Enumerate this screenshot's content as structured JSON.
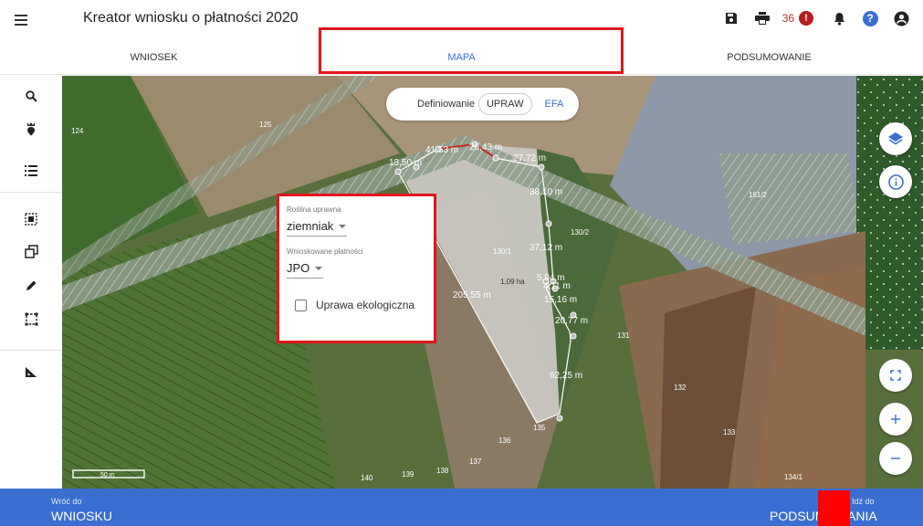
{
  "app": {
    "title": "Kreator wniosku o płatności 2020",
    "notification_count": "36"
  },
  "tabs": [
    {
      "label": "WNIOSEK"
    },
    {
      "label": "MAPA"
    },
    {
      "label": "PODSUMOWANIE"
    }
  ],
  "map_mode": {
    "label": "Definiowanie",
    "upraw": "UPRAW",
    "efa": "EFA"
  },
  "popup": {
    "crop_label": "Roślina uprawna",
    "crop_value": "ziemniak",
    "payments_label": "Wnioskowane płatności",
    "payments_value": "JPO",
    "eco_label": "Uprawa ekologiczna"
  },
  "parcels": [
    "124",
    "125",
    "130/2",
    "130/1",
    "161/2",
    "131",
    "132",
    "133",
    "134/1",
    "135",
    "136",
    "137",
    "138",
    "139",
    "140"
  ],
  "measurements": [
    "41,53 m",
    "25,43 m",
    "27,72 m",
    "13,50 m",
    "38,10 m",
    "37,12 m",
    "205,55 m",
    "5,94 m",
    "4,11 m",
    "15,16 m",
    "20,77 m",
    "62,25 m"
  ],
  "area_label": "1,09 ha",
  "scale_label": "50 m",
  "bottom": {
    "back_small": "Wróć do",
    "back_big": "WNIOSKU",
    "next_small": "Idź do",
    "next_big": "PODSUMOWANIA"
  },
  "icons": {
    "menu": "menu-icon",
    "save": "save-icon",
    "print": "print-icon",
    "error": "error-icon",
    "bell": "bell-icon",
    "help": "help-icon",
    "account": "account-icon",
    "search": "search-icon",
    "pin": "parcel-pin-icon",
    "list": "list-icon",
    "select": "select-area-icon",
    "copy": "copy-icon",
    "pencil": "pencil-icon",
    "frame": "frame-icon",
    "measure": "measure-icon",
    "layers": "layers-icon",
    "info": "info-icon",
    "fullscreen": "fullscreen-icon",
    "zoom_in": "zoom-in-icon",
    "zoom_out": "zoom-out-icon"
  },
  "colors": {
    "accent": "#3a6fd1",
    "highlight": "#e0161b",
    "error": "#b71c1c"
  }
}
